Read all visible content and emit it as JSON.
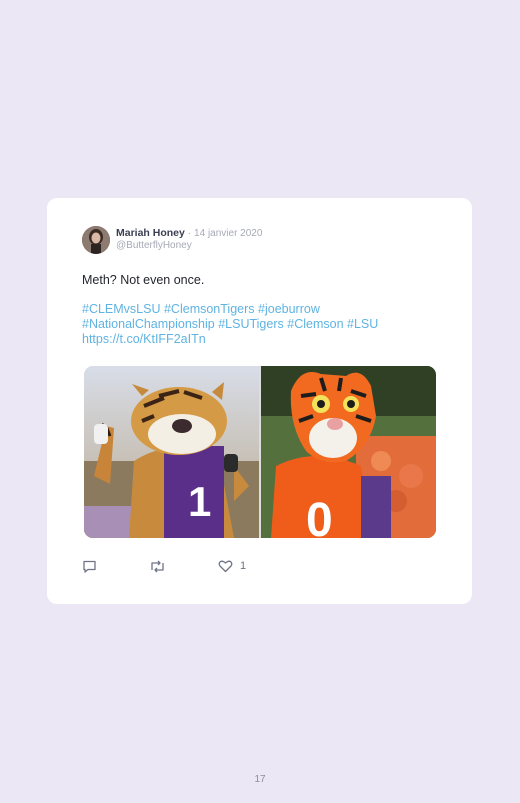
{
  "tweet": {
    "author_name": "Mariah Honey",
    "separator": "·",
    "date": "14 janvier 2020",
    "handle": "@ButterflyHoney",
    "text": "Meth? Not even once.",
    "hashtags": [
      "#CLEMvsLSU",
      "#ClemsonTigers",
      "#joeburrow",
      "#NationalChampionship",
      "#LSUTigers",
      "#Clemson",
      "#LSU"
    ],
    "link": "https://t.co/KtIFF2aITn",
    "media": [
      {
        "icon": "lsu-tiger-mascot-photo",
        "jersey_number": "1"
      },
      {
        "icon": "clemson-tiger-mascot-photo",
        "jersey_number": "0"
      }
    ],
    "actions": {
      "reply_icon": "reply-icon",
      "retweet_icon": "retweet-icon",
      "like_icon": "heart-icon",
      "like_count": "1"
    }
  },
  "page": {
    "number": "17"
  },
  "colors": {
    "background": "#ebe7f4",
    "card": "#ffffff",
    "link": "#5fb3e2",
    "text": "#23262e",
    "muted": "#a6a9b6"
  }
}
